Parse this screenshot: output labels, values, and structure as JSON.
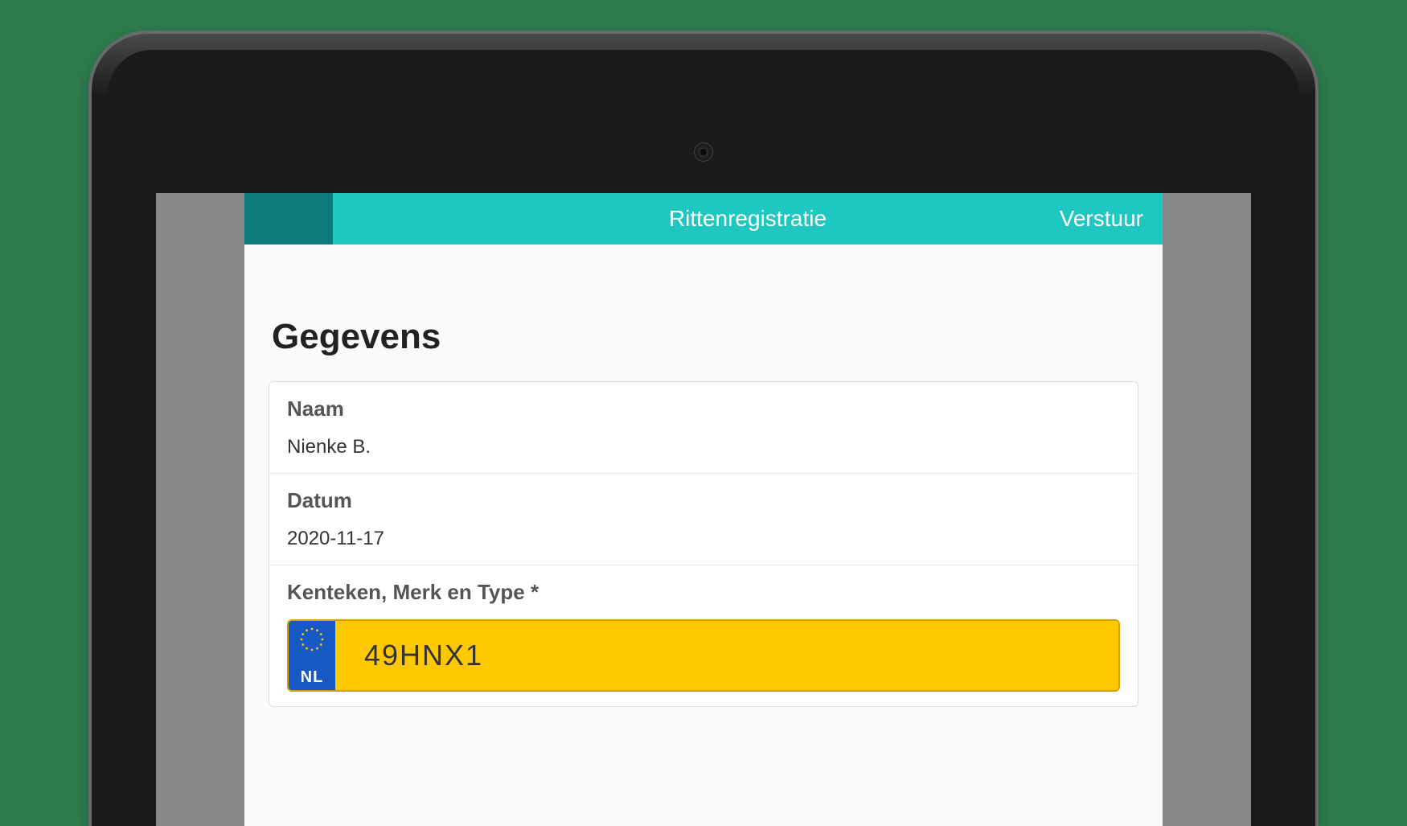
{
  "topbar": {
    "title": "Rittenregistratie",
    "action": "Verstuur"
  },
  "section": {
    "title": "Gegevens"
  },
  "fields": {
    "name": {
      "label": "Naam",
      "value": "Nienke B."
    },
    "date": {
      "label": "Datum",
      "value": "2020-11-17"
    },
    "plate": {
      "label": "Kenteken, Merk en Type *",
      "country": "NL",
      "value": "49HNX1"
    }
  }
}
